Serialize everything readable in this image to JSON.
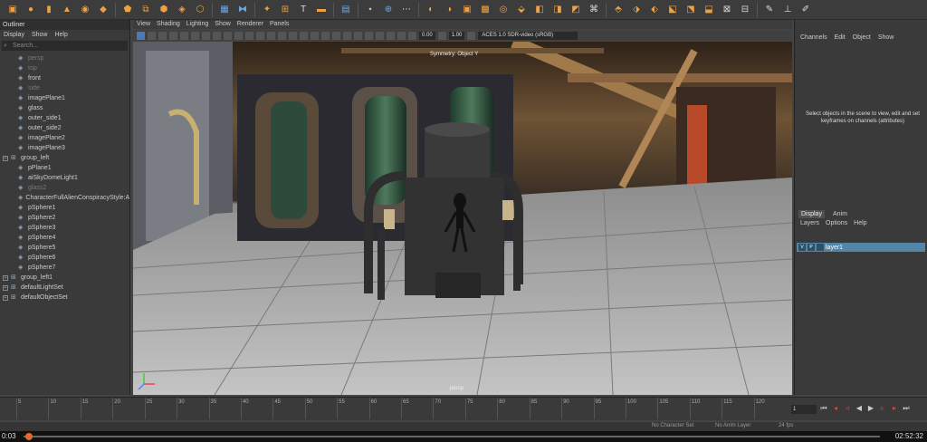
{
  "viewport_menu": [
    "View",
    "Shading",
    "Lighting",
    "Show",
    "Renderer",
    "Panels"
  ],
  "viewport_tools": {
    "exposure": "0.00",
    "gamma": "1.00",
    "colorspace": "ACES 1.0 SDR-video (sRGB)"
  },
  "viewport_labels": {
    "symmetry": "Symmetry: Object Y",
    "camera": "persp"
  },
  "outliner": {
    "title": "Outliner",
    "menu": [
      "Display",
      "Show",
      "Help"
    ],
    "search_placeholder": "Search...",
    "items": [
      {
        "label": "persp",
        "dim": true,
        "group": false
      },
      {
        "label": "top",
        "dim": true,
        "group": false
      },
      {
        "label": "front",
        "dim": false,
        "group": false
      },
      {
        "label": "side",
        "dim": true,
        "group": false
      },
      {
        "label": "imagePlane1",
        "dim": false,
        "group": false
      },
      {
        "label": "glass",
        "dim": false,
        "group": false
      },
      {
        "label": "outer_side1",
        "dim": false,
        "group": false
      },
      {
        "label": "outer_side2",
        "dim": false,
        "group": false
      },
      {
        "label": "imagePlane2",
        "dim": false,
        "group": false
      },
      {
        "label": "imagePlane3",
        "dim": false,
        "group": false
      },
      {
        "label": "group_left",
        "dim": false,
        "group": true
      },
      {
        "label": "pPlane1",
        "dim": false,
        "group": false
      },
      {
        "label": "aiSkyDomeLight1",
        "dim": false,
        "group": false
      },
      {
        "label": "glass2",
        "dim": true,
        "group": false
      },
      {
        "label": "CharacterFullAlienConspiracyStyle:Ali",
        "dim": false,
        "group": false
      },
      {
        "label": "pSphere1",
        "dim": false,
        "group": false
      },
      {
        "label": "pSphere2",
        "dim": false,
        "group": false
      },
      {
        "label": "pSphere3",
        "dim": false,
        "group": false
      },
      {
        "label": "pSphere4",
        "dim": false,
        "group": false
      },
      {
        "label": "pSphere5",
        "dim": false,
        "group": false
      },
      {
        "label": "pSphere6",
        "dim": false,
        "group": false
      },
      {
        "label": "pSphere7",
        "dim": false,
        "group": false
      },
      {
        "label": "group_left1",
        "dim": false,
        "group": true
      },
      {
        "label": "defaultLightSet",
        "dim": false,
        "group": true
      },
      {
        "label": "defaultObjectSet",
        "dim": false,
        "group": true
      }
    ]
  },
  "channel_box": {
    "menu": [
      "Channels",
      "Edit",
      "Object",
      "Show"
    ],
    "message": "Select objects in the scene to view, edit and set keyframes on channels (attributes)"
  },
  "layer_editor": {
    "tabs": [
      "Display",
      "Anim"
    ],
    "menu": [
      "Layers",
      "Options",
      "Help"
    ],
    "layer": {
      "v": "V",
      "p": "P",
      "name": "layer1"
    }
  },
  "timeline": {
    "ticks": [
      "5",
      "10",
      "15",
      "20",
      "25",
      "30",
      "35",
      "40",
      "45",
      "50",
      "55",
      "60",
      "65",
      "70",
      "75",
      "80",
      "85",
      "90",
      "95",
      "100",
      "105",
      "110",
      "115",
      "120"
    ],
    "current_frame": "1",
    "range_labels": {
      "no_character": "No Character Set",
      "no_anim": "No Anim Layer",
      "fps": "24 fps"
    }
  },
  "player": {
    "elapsed": "0:03",
    "total": "02:52:32"
  }
}
